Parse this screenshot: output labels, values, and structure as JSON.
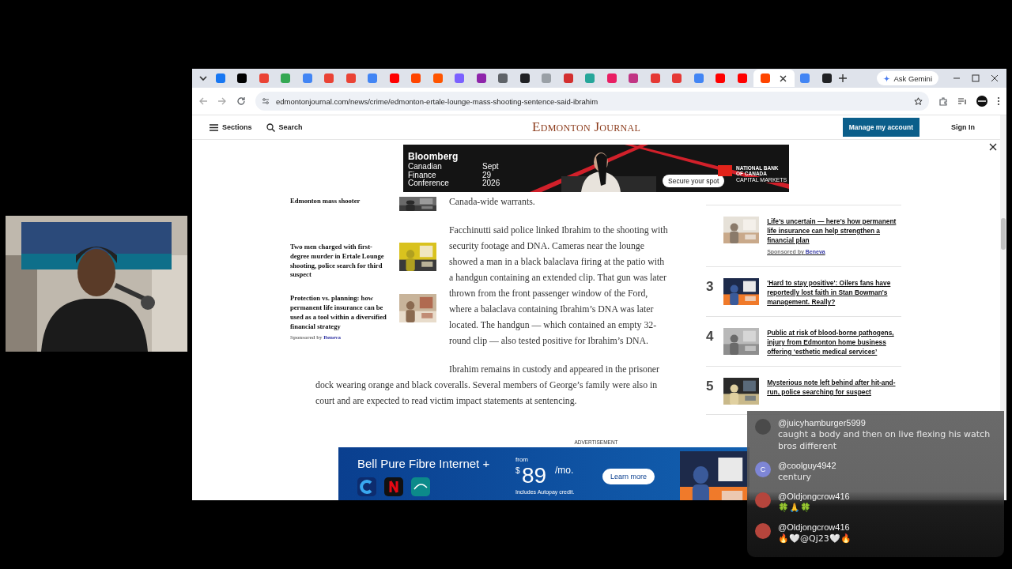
{
  "browser": {
    "tabs": [
      {
        "color": "#1877f2",
        "selected": false
      },
      {
        "color": "#000000",
        "selected": false
      },
      {
        "color": "#ea4335",
        "selected": false
      },
      {
        "color": "#34a853",
        "selected": false
      },
      {
        "color": "#4285f4",
        "selected": false
      },
      {
        "color": "#ea4335",
        "selected": false
      },
      {
        "color": "#ea4335",
        "selected": false
      },
      {
        "color": "#4285f4",
        "selected": false
      },
      {
        "color": "#ff0000",
        "selected": false
      },
      {
        "color": "#ff4500",
        "selected": false
      },
      {
        "color": "#ff5500",
        "selected": false
      },
      {
        "color": "#7b61ff",
        "selected": false
      },
      {
        "color": "#8e24aa",
        "selected": false
      },
      {
        "color": "#5f6368",
        "selected": false
      },
      {
        "color": "#202124",
        "selected": false
      },
      {
        "color": "#9aa0a6",
        "selected": false
      },
      {
        "color": "#d32f2f",
        "selected": false
      },
      {
        "color": "#26a69a",
        "selected": false
      },
      {
        "color": "#e91e63",
        "selected": false
      },
      {
        "color": "#c13584",
        "selected": false
      },
      {
        "color": "#e53935",
        "selected": false
      },
      {
        "color": "#e53935",
        "selected": false
      },
      {
        "color": "#4285f4",
        "selected": false
      },
      {
        "color": "#ff0000",
        "selected": false
      },
      {
        "color": "#ff0000",
        "selected": false
      },
      {
        "color": "#ff4500",
        "selected": true
      },
      {
        "color": "#4285f4",
        "selected": false
      },
      {
        "color": "#202124",
        "selected": false
      }
    ],
    "ask_gemini": "Ask Gemini",
    "url": "edmontonjournal.com/news/crime/edmonton-ertale-lounge-mass-shooting-sentence-said-ibrahim"
  },
  "site_header": {
    "sections": "Sections",
    "search": "Search",
    "logo": "Edmonton Journal",
    "account_button": "Manage my account",
    "sign_in": "Sign In"
  },
  "top_ad": {
    "brand": "Bloomberg",
    "event_lines": [
      "Canadian",
      "Finance",
      "Conference"
    ],
    "date_lines": [
      "Sept",
      "29",
      "2026"
    ],
    "cta": "Secure your spot",
    "sponsor_lines": [
      "NATIONAL BANK",
      "OF CANADA"
    ],
    "sponsor_sub": "CAPITAL MARKETS"
  },
  "related": [
    {
      "title": "Edmonton mass shooter"
    },
    {
      "title": "Two men charged with first-degree murder in Ertale Lounge shooting, police search for third suspect"
    },
    {
      "title": "Protection vs. planning: how permanent life insurance can be used as a tool within a diversified financial strategy",
      "sponsored_label": "Sponsored by",
      "sponsor": "Beneva"
    }
  ],
  "article": {
    "paragraphs": [
      "Canada-wide warrants.",
      "Facchinutti said police linked Ibrahim to the shooting with security footage and DNA. Cameras near the lounge showed a man in a black balaclava firing at the patio with a handgun containing an extended clip. That gun was later thrown from the front passenger window of the Ford, where a balaclava containing Ibrahim’s DNA was later located. The handgun — which contained an empty 32-round clip — also tested positive for Ibrahim’s DNA.",
      "Ibrahim remains in custody and appeared in the prisoner dock wearing orange and black coveralls. Several members of George’s family were also in court and are expected to read victim impact statements at sentencing."
    ]
  },
  "trending": [
    {
      "title": "Life’s uncertain — here’s how permanent life insurance can help strengthen a financial plan",
      "sponsored_label": "Sponsored by",
      "sponsor": "Beneva"
    },
    {
      "rank": "3",
      "title": "'Hard to stay positive': Oilers fans have reportedly lost faith in Stan Bowman's management. Really?"
    },
    {
      "rank": "4",
      "title": "Public at risk of blood-borne pathogens, injury from Edmonton home business offering ‘esthetic medical services’"
    },
    {
      "rank": "5",
      "title": "Mysterious note left behind after hit-and-run, police searching for suspect"
    }
  ],
  "bottom_ad": {
    "label": "ADVERTISEMENT",
    "headline": "Bell Pure Fibre Internet +",
    "from": "from",
    "currency": "$",
    "price": "89",
    "per": "/mo.",
    "note": "Includes Autopay credit.",
    "cta": "Learn more"
  },
  "chat": [
    {
      "user": "@juicyhamburger5999",
      "text": "caught a body and then on live flexing his watch bros different",
      "color": "#4a4a4a"
    },
    {
      "user": "@coolguy4942",
      "text": "century",
      "color": "#7e86d6",
      "initial": "C"
    },
    {
      "user": "@Oldjongcrow416",
      "text": "🍀🙏🍀",
      "color": "#b5453c"
    },
    {
      "user": "@Oldjongcrow416",
      "text": "🔥🤍@Qj23🤍🔥",
      "color": "#b5453c"
    }
  ]
}
